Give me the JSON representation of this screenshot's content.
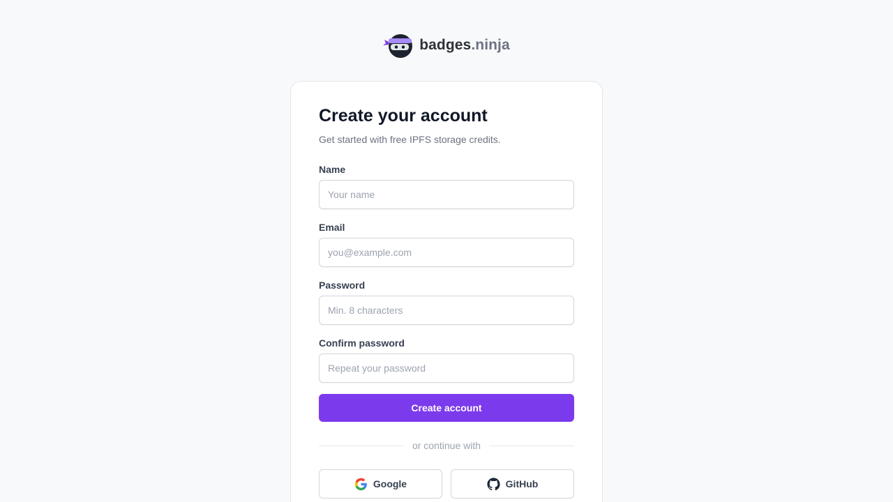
{
  "brand": {
    "name_main": "badges",
    "name_accent": ".ninja",
    "logo_icon": "ninja-mascot-icon"
  },
  "form": {
    "title": "Create your account",
    "subtitle": "Get started with free IPFS storage credits.",
    "fields": [
      {
        "label": "Name",
        "value": "",
        "placeholder": "Your name",
        "type": "text"
      },
      {
        "label": "Email",
        "value": "",
        "placeholder": "you@example.com",
        "type": "email"
      },
      {
        "label": "Password",
        "value": "",
        "placeholder": "Min. 8 characters",
        "type": "password"
      },
      {
        "label": "Confirm password",
        "value": "",
        "placeholder": "Repeat your password",
        "type": "password"
      }
    ],
    "submit_label": "Create account",
    "divider_text": "or continue with",
    "oauth": [
      {
        "label": "Google",
        "icon": "google-icon"
      },
      {
        "label": "GitHub",
        "icon": "github-icon"
      }
    ]
  },
  "colors": {
    "accent": "#7c3aed",
    "background": "#f8f9fb",
    "card": "#ffffff"
  }
}
